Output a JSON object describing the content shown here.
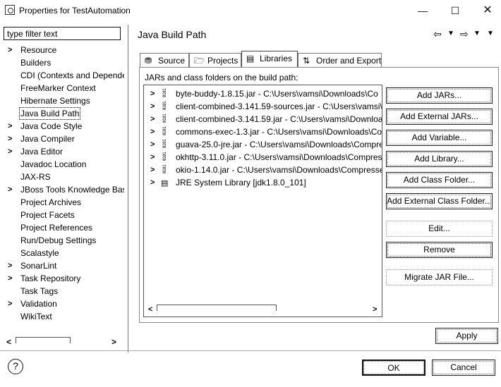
{
  "window": {
    "title": "Properties for TestAutomation",
    "minimize_glyph": "—",
    "maximize_glyph": "☐",
    "close_glyph": "✕"
  },
  "filter": {
    "placeholder": "type filter text",
    "value": ""
  },
  "nav": {
    "items": [
      {
        "label": "Resource",
        "expandable": true
      },
      {
        "label": "Builders",
        "expandable": false
      },
      {
        "label": "CDI (Contexts and Depende",
        "expandable": false
      },
      {
        "label": "FreeMarker Context",
        "expandable": false
      },
      {
        "label": "Hibernate Settings",
        "expandable": false
      },
      {
        "label": "Java Build Path",
        "expandable": false,
        "selected": true
      },
      {
        "label": "Java Code Style",
        "expandable": true
      },
      {
        "label": "Java Compiler",
        "expandable": true
      },
      {
        "label": "Java Editor",
        "expandable": true
      },
      {
        "label": "Javadoc Location",
        "expandable": false
      },
      {
        "label": "JAX-RS",
        "expandable": false
      },
      {
        "label": "JBoss Tools Knowledge Bas",
        "expandable": true
      },
      {
        "label": "Project Archives",
        "expandable": false
      },
      {
        "label": "Project Facets",
        "expandable": false
      },
      {
        "label": "Project References",
        "expandable": false
      },
      {
        "label": "Run/Debug Settings",
        "expandable": false
      },
      {
        "label": "Scalastyle",
        "expandable": false
      },
      {
        "label": "SonarLint",
        "expandable": true
      },
      {
        "label": "Task Repository",
        "expandable": true
      },
      {
        "label": "Task Tags",
        "expandable": false
      },
      {
        "label": "Validation",
        "expandable": true
      },
      {
        "label": "WikiText",
        "expandable": false
      }
    ],
    "scroll_left": "<",
    "scroll_right": ">"
  },
  "page": {
    "title": "Java Build Path",
    "back_glyph": "⇦",
    "forward_glyph": "⇨",
    "dropdown_glyph": "▼"
  },
  "tabs": [
    {
      "label": "Source",
      "icon": "source-folder-icon",
      "glyph": "⛃"
    },
    {
      "label": "Projects",
      "icon": "project-icon",
      "glyph": "🗁"
    },
    {
      "label": "Libraries",
      "icon": "libraries-icon",
      "glyph": "▤",
      "active": true
    },
    {
      "label": "Order and Export",
      "icon": "order-export-icon",
      "glyph": "⇅"
    }
  ],
  "libraries": {
    "caption": "JARs and class folders on the build path:",
    "items": [
      {
        "label": "byte-buddy-1.8.15.jar - C:\\Users\\vamsi\\Downloads\\Co",
        "kind": "jar"
      },
      {
        "label": "client-combined-3.141.59-sources.jar - C:\\Users\\vamsi\\",
        "kind": "jar"
      },
      {
        "label": "client-combined-3.141.59.jar - C:\\Users\\vamsi\\Downloa",
        "kind": "jar"
      },
      {
        "label": "commons-exec-1.3.jar - C:\\Users\\vamsi\\Downloads\\Co",
        "kind": "jar"
      },
      {
        "label": "guava-25.0-jre.jar - C:\\Users\\vamsi\\Downloads\\Compre",
        "kind": "jar"
      },
      {
        "label": "okhttp-3.11.0.jar - C:\\Users\\vamsi\\Downloads\\Compres",
        "kind": "jar"
      },
      {
        "label": "okio-1.14.0.jar - C:\\Users\\vamsi\\Downloads\\Compresse",
        "kind": "jar"
      },
      {
        "label": "JRE System Library [jdk1.8.0_101]",
        "kind": "jre"
      }
    ],
    "scroll_left": "<",
    "scroll_right": ">"
  },
  "buttons": {
    "add_jars": "Add JARs...",
    "add_external_jars": "Add External JARs...",
    "add_variable": "Add Variable...",
    "add_library": "Add Library...",
    "add_class_folder": "Add Class Folder...",
    "add_external_class_folder": "Add External Class Folder...",
    "edit": "Edit...",
    "remove": "Remove",
    "migrate_jar": "Migrate JAR File...",
    "apply": "Apply",
    "ok": "OK",
    "cancel": "Cancel"
  },
  "help": {
    "glyph": "?"
  }
}
